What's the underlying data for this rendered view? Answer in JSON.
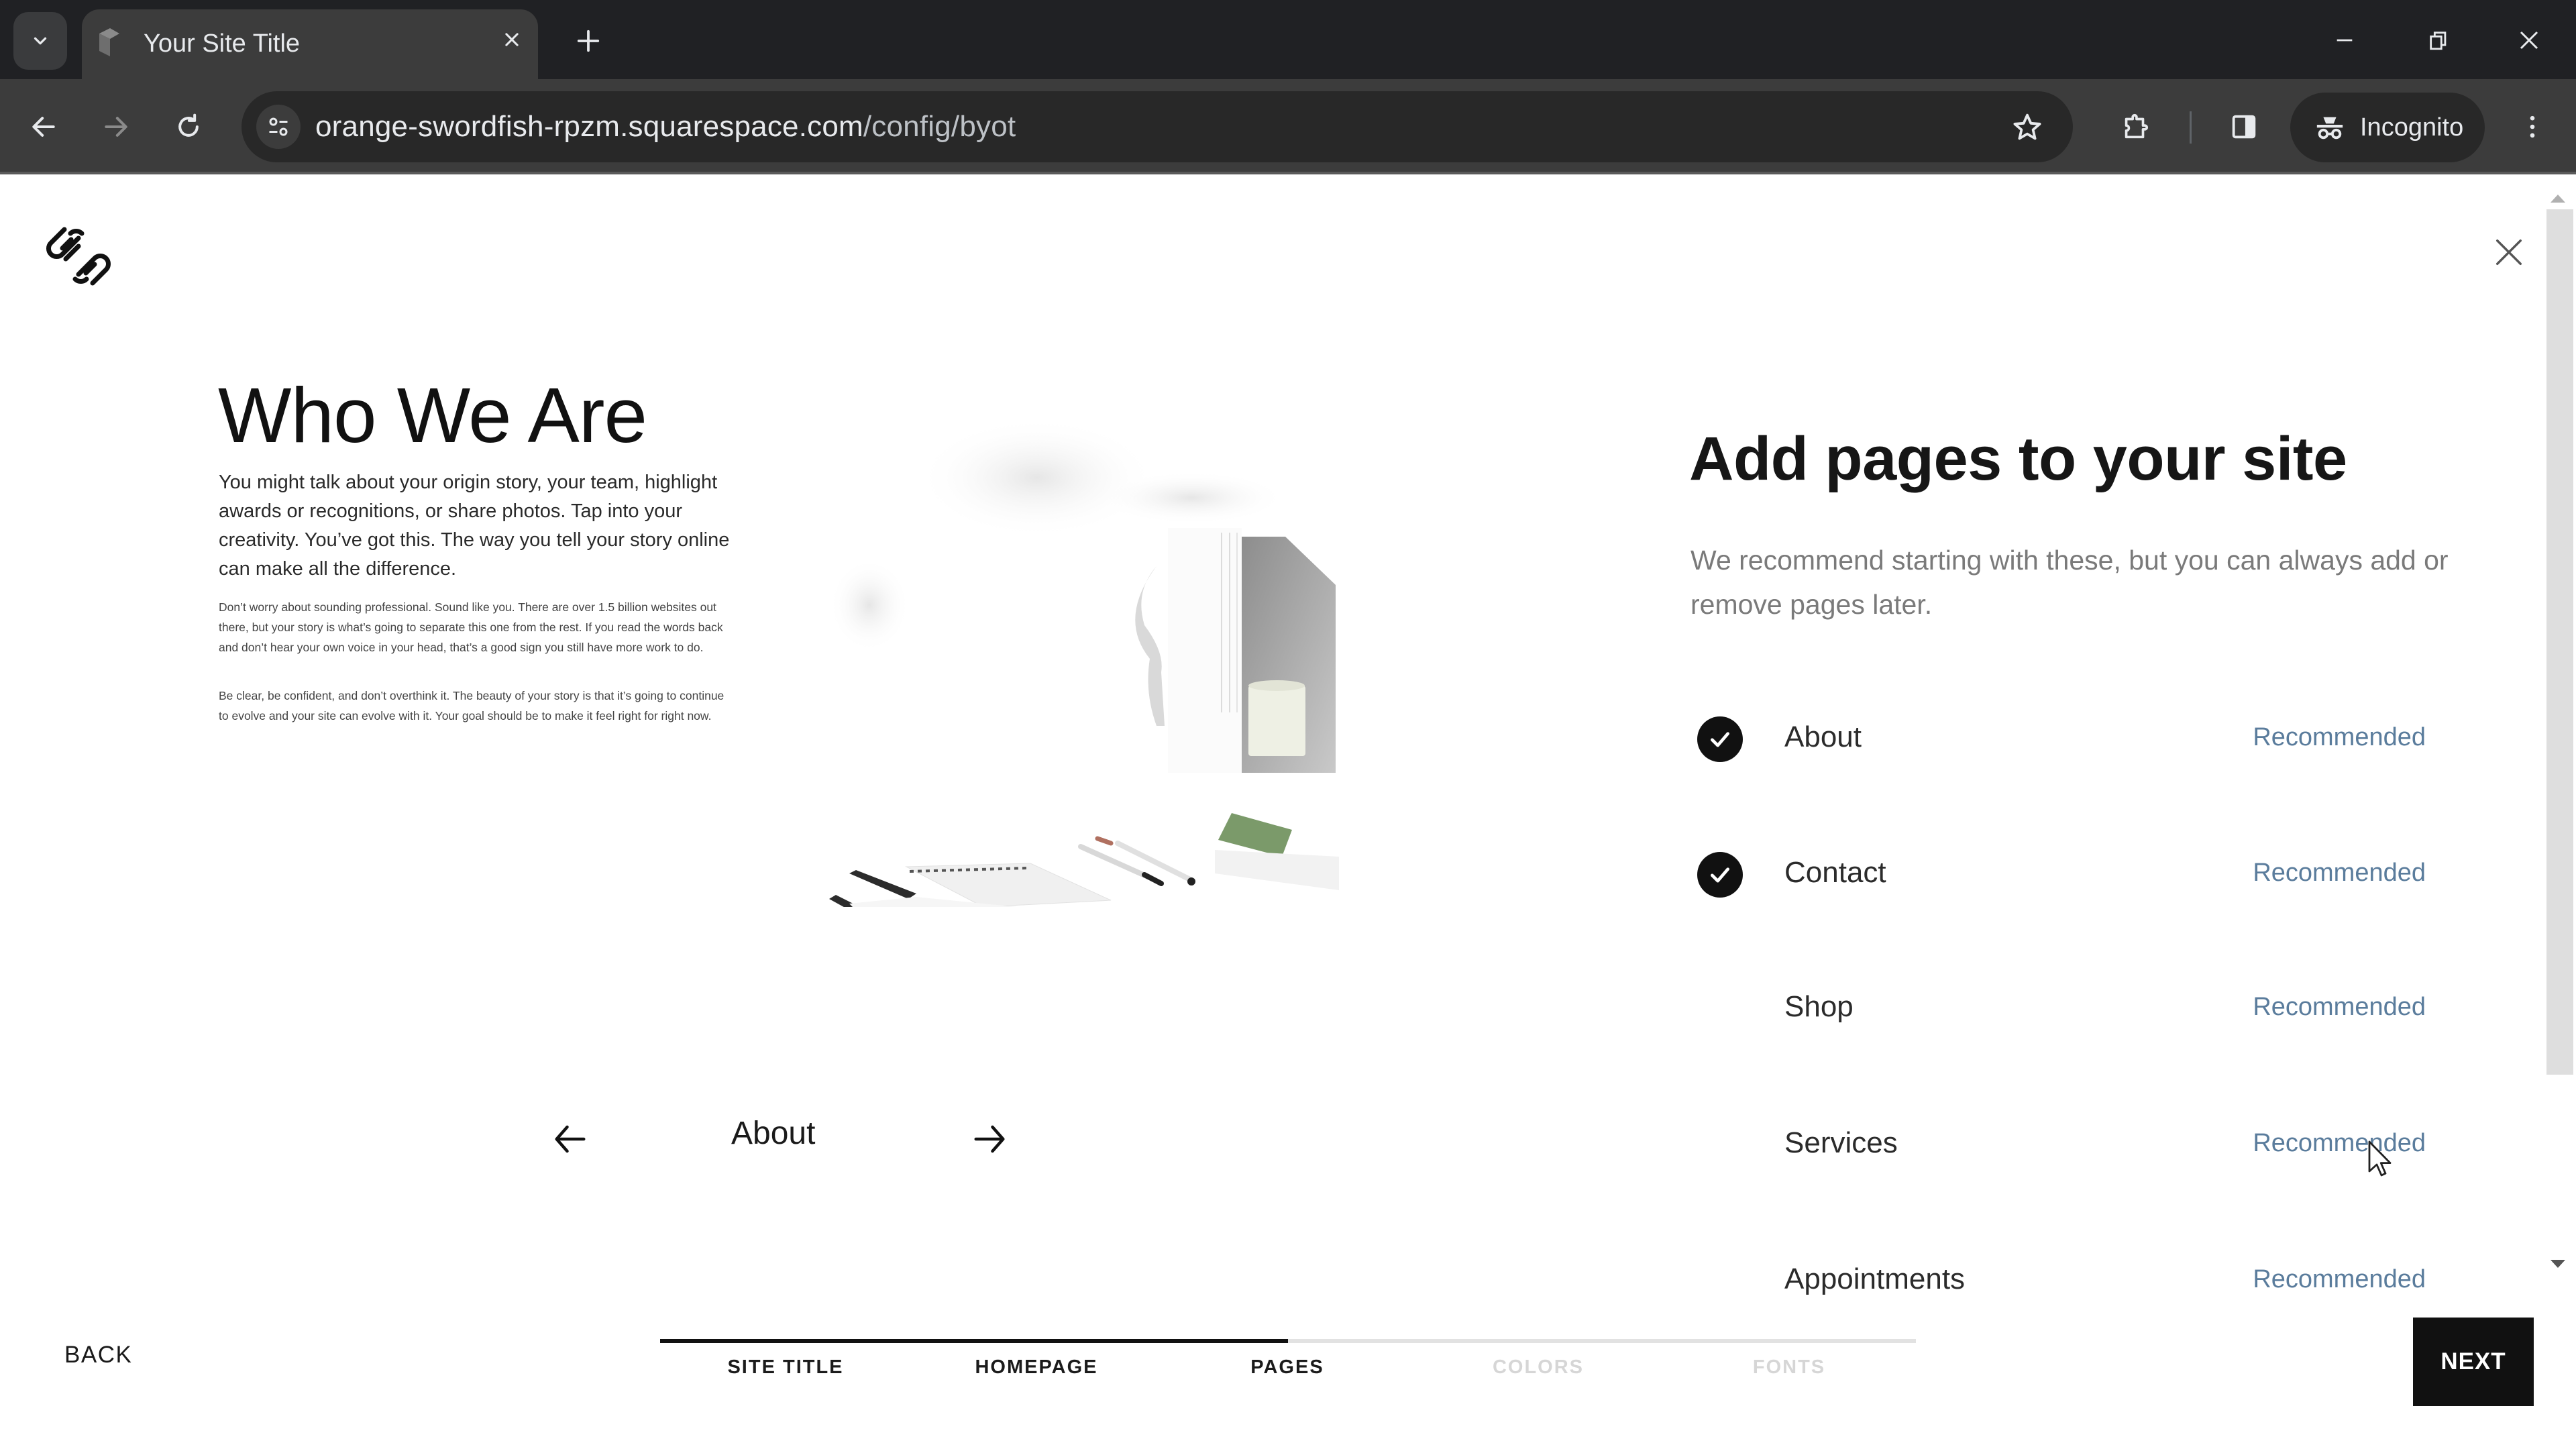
{
  "browser": {
    "tab_title": "Your Site Title",
    "url_host": "orange-swordfish-rpzm.squarespace.com",
    "url_path": "/config/byot",
    "profile_label": "Incognito",
    "icons": {
      "tab_search": "chevron-down-icon",
      "tab_close": "close-icon",
      "new_tab": "plus-icon",
      "minimize": "minimize-icon",
      "restore": "restore-icon",
      "window_close": "close-icon",
      "back": "arrow-left-icon",
      "forward": "arrow-right-icon",
      "reload": "reload-icon",
      "site_info": "tune-icon",
      "bookmark": "star-icon",
      "extensions": "puzzle-icon",
      "side_panel": "side-panel-icon",
      "incognito": "incognito-icon",
      "menu": "kebab-menu-icon"
    }
  },
  "app": {
    "logo": "squarespace-logo-icon",
    "close_icon": "close-icon"
  },
  "preview": {
    "title": "Who We Are",
    "body": "You might talk about your origin story, your team, highlight awards or recognitions, or share photos. Tap into your creativity. You’ve got this. The way you tell your story online can make all the difference.",
    "small_paragraph_1": "Don’t worry about sounding professional. Sound like you. There are over 1.5 billion websites out there, but your story is what’s going to separate this one from the rest. If you read the words back and don’t hear your own voice in your head, that’s a good sign you still have more work to do.",
    "small_paragraph_2": "Be clear, be confident, and don’t overthink it. The beauty of your story is that it’s going to continue to evolve and your site can evolve with it. Your goal should be to make it feel right for right now.",
    "image_description": "desk-still-life-image",
    "carousel_label": "About",
    "prev_icon": "arrow-left-icon",
    "next_icon": "arrow-right-icon"
  },
  "panel": {
    "title": "Add pages to your site",
    "subtitle": "We recommend starting with these, but you can always add or remove pages later.",
    "pages": [
      {
        "label": "About",
        "badge": "Recommended",
        "selected": true
      },
      {
        "label": "Contact",
        "badge": "Recommended",
        "selected": true
      },
      {
        "label": "Shop",
        "badge": "Recommended",
        "selected": false
      },
      {
        "label": "Services",
        "badge": "Recommended",
        "selected": false
      },
      {
        "label": "Appointments",
        "badge": "Recommended",
        "selected": false
      }
    ]
  },
  "footer": {
    "back_label": "BACK",
    "next_label": "NEXT",
    "progress_fraction": 0.5,
    "steps": [
      {
        "label": "SITE TITLE",
        "state": "done"
      },
      {
        "label": "HOMEPAGE",
        "state": "done"
      },
      {
        "label": "PAGES",
        "state": "current"
      },
      {
        "label": "COLORS",
        "state": "todo"
      },
      {
        "label": "FONTS",
        "state": "todo"
      }
    ]
  },
  "colors": {
    "accent_recommended": "#5a7c9c",
    "primary_button": "#111111",
    "chrome_dark": "#202124",
    "chrome_toolbar": "#3c3c3c"
  }
}
